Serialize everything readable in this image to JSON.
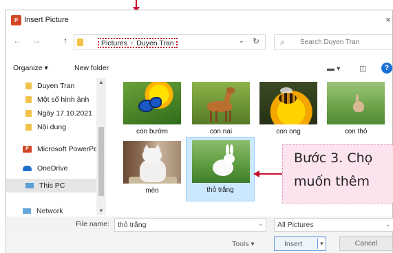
{
  "window": {
    "title": "Insert Picture",
    "close": "×",
    "app_icon_letter": "P"
  },
  "nav": {
    "back": "←",
    "forward": "→",
    "up": "↑"
  },
  "address": {
    "crumbs": [
      "Pictures",
      "Duyen Tran"
    ],
    "separator": "›",
    "refresh": "↻",
    "dropdown": "⌄"
  },
  "search": {
    "placeholder": "Search Duyen Tran",
    "icon": "⌕"
  },
  "toolbar": {
    "organize": "Organize ▾",
    "new_folder": "New folder",
    "help": "?"
  },
  "sidebar": {
    "items": [
      {
        "label": "Duyen Tran",
        "icon": "folder-icon"
      },
      {
        "label": "Một số hình ảnh",
        "icon": "folder-icon"
      },
      {
        "label": "Ngày 17.10.2021",
        "icon": "folder-icon"
      },
      {
        "label": "Nội dung",
        "icon": "folder-icon"
      },
      {
        "label": "Microsoft PowerPc",
        "icon": "powerpoint-icon"
      },
      {
        "label": "OneDrive",
        "icon": "cloud-icon"
      },
      {
        "label": "This PC",
        "icon": "pc-icon"
      },
      {
        "label": "Network",
        "icon": "network-icon"
      }
    ]
  },
  "files": [
    {
      "name": "con bướm",
      "image": "butterfly"
    },
    {
      "name": "con nai",
      "image": "deer"
    },
    {
      "name": "con ong",
      "image": "bee"
    },
    {
      "name": "con thỏ",
      "image": "rabbit"
    },
    {
      "name": "mèo",
      "image": "cat"
    },
    {
      "name": "thỏ trắng",
      "image": "white-rabbit",
      "selected": true
    }
  ],
  "bottom": {
    "file_name_label": "File name:",
    "file_name_value": "thỏ trắng",
    "filter_value": "All Pictures",
    "tools_label": "Tools ▾",
    "insert_label": "Insert",
    "cancel_label": "Cancel"
  },
  "callout": {
    "line1": "Bước 3. Chọ",
    "line2": "muốn thêm"
  },
  "colors": {
    "accent_red": "#c8102e",
    "selection_blue": "#cce8ff",
    "callout_pink": "#fce4ef"
  }
}
